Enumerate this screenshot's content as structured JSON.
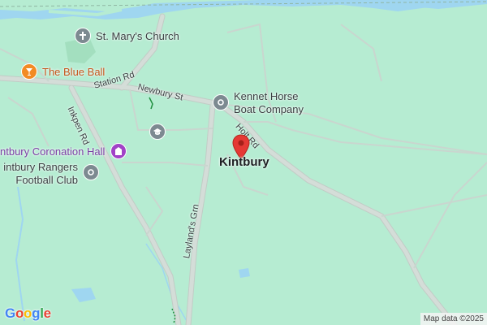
{
  "colors": {
    "land": "#b6ecd2",
    "water": "#9fd6f0",
    "road": "#d4ddd8",
    "road_casing": "#c2ccc6",
    "park": "#a3dfbf",
    "pin": "#e53935",
    "google_blue": "#4285F4",
    "google_red": "#EA4335",
    "google_yellow": "#FBBC05",
    "google_green": "#34A853"
  },
  "roads": {
    "station_rd": "Station Rd",
    "newbury_st": "Newbury St",
    "inkpen_rd": "Inkpen Rd",
    "holt_rd": "Holt Rd",
    "laylands_grn": "Layland's Grn"
  },
  "pois": {
    "st_marys": {
      "label": "St. Mary's Church",
      "icon": "church-icon"
    },
    "blue_ball": {
      "label": "The Blue Ball",
      "icon": "bar-icon"
    },
    "kennet_horse": {
      "label_line1": "Kennet Horse",
      "label_line2": "Boat Company",
      "icon": "place-icon"
    },
    "school": {
      "icon": "school-icon"
    },
    "coronation_hall": {
      "label": "ntbury Coronation Hall",
      "icon": "hall-icon"
    },
    "rangers": {
      "label_line1": "intbury Rangers",
      "label_line2": "Football Club",
      "icon": "place-icon"
    }
  },
  "town": {
    "label": "Kintbury",
    "icon": "map-pin-icon"
  },
  "footer": {
    "logo_letters": [
      "G",
      "o",
      "o",
      "g",
      "l",
      "e"
    ],
    "attribution": "Map data ©2025"
  }
}
